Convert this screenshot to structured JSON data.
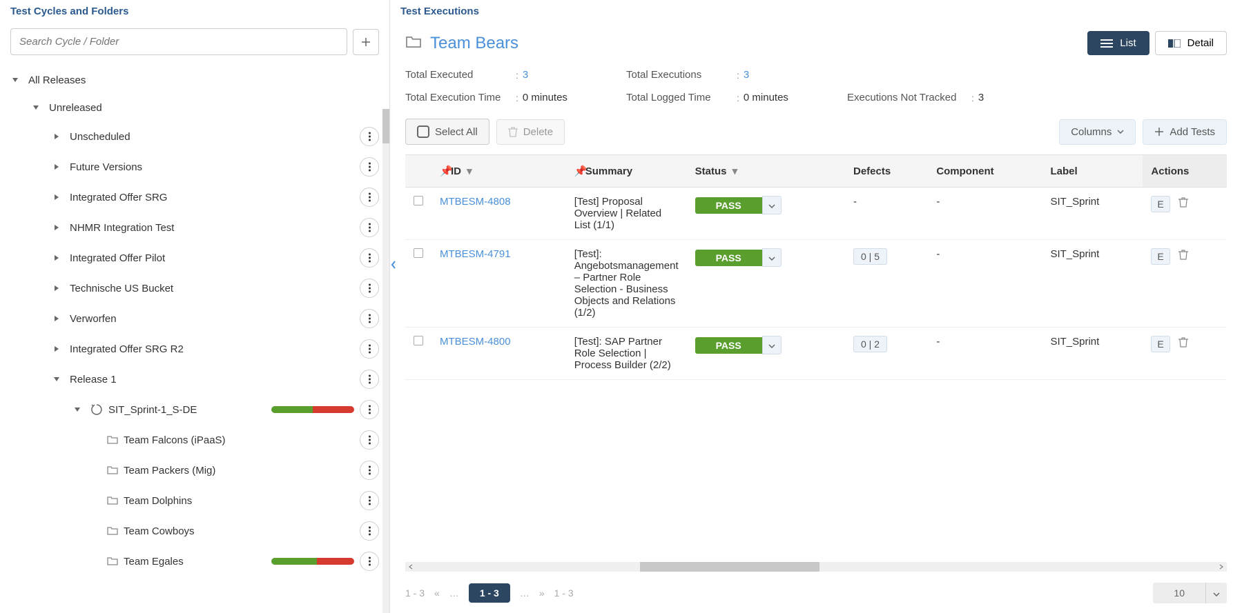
{
  "leftPanel": {
    "title": "Test Cycles and Folders",
    "searchPlaceholder": "Search Cycle / Folder",
    "tree": {
      "root": "All Releases",
      "unreleased": "Unreleased",
      "items": [
        {
          "label": "Unscheduled"
        },
        {
          "label": "Future Versions"
        },
        {
          "label": "Integrated Offer SRG"
        },
        {
          "label": "NHMR Integration Test"
        },
        {
          "label": "Integrated Offer Pilot"
        },
        {
          "label": "Technische US Bucket"
        },
        {
          "label": "Verworfen"
        },
        {
          "label": "Integrated Offer SRG R2"
        }
      ],
      "release1": "Release 1",
      "sprint": "SIT_Sprint-1_S-DE",
      "sprintProgress": {
        "green": 50,
        "red": 50
      },
      "teams": [
        {
          "label": "Team Falcons (iPaaS)"
        },
        {
          "label": "Team Packers (Mig)"
        },
        {
          "label": "Team Dolphins"
        },
        {
          "label": "Team Cowboys"
        },
        {
          "label": "Team Egales",
          "progress": {
            "green": 55,
            "red": 45
          }
        }
      ]
    }
  },
  "rightPanel": {
    "title": "Test Executions",
    "breadcrumb": "Team Bears",
    "viewList": "List",
    "viewDetail": "Detail",
    "stats": {
      "totalExecuted": {
        "label": "Total Executed",
        "value": "3"
      },
      "totalExecutions": {
        "label": "Total Executions",
        "value": "3"
      },
      "totalExecutionTime": {
        "label": "Total Execution Time",
        "value": "0 minutes"
      },
      "totalLoggedTime": {
        "label": "Total Logged Time",
        "value": "0 minutes"
      },
      "notTracked": {
        "label": "Executions Not Tracked",
        "value": "3"
      }
    },
    "toolbar": {
      "selectAll": "Select All",
      "delete": "Delete",
      "columns": "Columns",
      "addTests": "Add Tests"
    },
    "columns": {
      "id": "ID",
      "summary": "Summary",
      "status": "Status",
      "defects": "Defects",
      "component": "Component",
      "label": "Label",
      "actions": "Actions"
    },
    "rows": [
      {
        "id": "MTBESM-4808",
        "summary": "[Test] Proposal Overview | Related List (1/1)",
        "status": "PASS",
        "defects": "-",
        "component": "-",
        "label": "SIT_Sprint"
      },
      {
        "id": "MTBESM-4791",
        "summary": "[Test]: Angebotsmanagement – Partner Role Selection - Business Objects and Relations (1/2)",
        "status": "PASS",
        "defects": "0 | 5",
        "component": "-",
        "label": "SIT_Sprint"
      },
      {
        "id": "MTBESM-4800",
        "summary": "[Test]: SAP Partner Role Selection | Process Builder (2/2)",
        "status": "PASS",
        "defects": "0 | 2",
        "component": "-",
        "label": "SIT_Sprint"
      }
    ],
    "eBadge": "E",
    "pager": {
      "range": "1 - 3",
      "current": "1 - 3",
      "total": "1 - 3",
      "pageSize": "10"
    }
  }
}
